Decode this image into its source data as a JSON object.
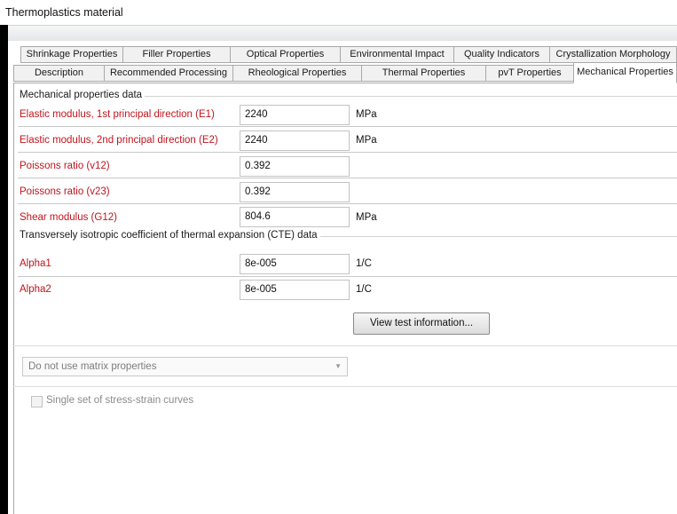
{
  "window": {
    "title": "Thermoplastics material"
  },
  "tabs": {
    "row1": [
      "Shrinkage Properties",
      "Filler Properties",
      "Optical Properties",
      "Environmental Impact",
      "Quality Indicators",
      "Crystallization Morphology"
    ],
    "row2": [
      "Description",
      "Recommended Processing",
      "Rheological Properties",
      "Thermal Properties",
      "pvT Properties",
      "Mechanical Properties"
    ],
    "active": "Mechanical Properties"
  },
  "mechanical": {
    "title": "Mechanical properties data",
    "rows": [
      {
        "label": "Elastic modulus, 1st principal direction (E1)",
        "value": "2240",
        "unit": "MPa"
      },
      {
        "label": "Elastic modulus, 2nd principal direction (E2)",
        "value": "2240",
        "unit": "MPa"
      },
      {
        "label": "Poissons ratio (v12)",
        "value": "0.392",
        "unit": ""
      },
      {
        "label": "Poissons ratio (v23)",
        "value": "0.392",
        "unit": ""
      },
      {
        "label": "Shear modulus (G12)",
        "value": "804.6",
        "unit": "MPa"
      }
    ]
  },
  "cte": {
    "title": "Transversely isotropic coefficient of thermal expansion (CTE) data",
    "rows": [
      {
        "label": "Alpha1",
        "value": "8e-005",
        "unit": "1/C"
      },
      {
        "label": "Alpha2",
        "value": "8e-005",
        "unit": "1/C"
      }
    ]
  },
  "buttons": {
    "view_test_information": "View test information..."
  },
  "matrix": {
    "selected": "Do not use matrix properties"
  },
  "stress_strain": {
    "label": "Single set of stress-strain curves",
    "checked": false
  },
  "colors": {
    "label_red": "#c0141c",
    "window_frame": "#000000"
  }
}
